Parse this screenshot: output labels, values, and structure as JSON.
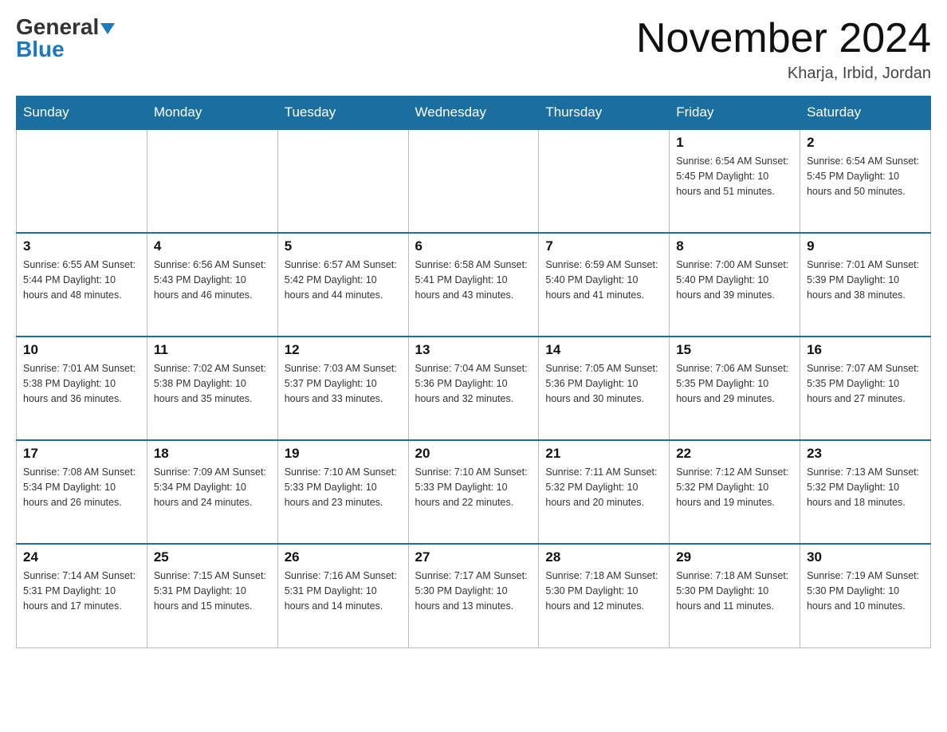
{
  "header": {
    "title": "November 2024",
    "location": "Kharja, Irbid, Jordan",
    "logo_general": "General",
    "logo_blue": "Blue"
  },
  "days_of_week": [
    "Sunday",
    "Monday",
    "Tuesday",
    "Wednesday",
    "Thursday",
    "Friday",
    "Saturday"
  ],
  "weeks": [
    [
      {
        "day": "",
        "info": ""
      },
      {
        "day": "",
        "info": ""
      },
      {
        "day": "",
        "info": ""
      },
      {
        "day": "",
        "info": ""
      },
      {
        "day": "",
        "info": ""
      },
      {
        "day": "1",
        "info": "Sunrise: 6:54 AM\nSunset: 5:45 PM\nDaylight: 10 hours\nand 51 minutes."
      },
      {
        "day": "2",
        "info": "Sunrise: 6:54 AM\nSunset: 5:45 PM\nDaylight: 10 hours\nand 50 minutes."
      }
    ],
    [
      {
        "day": "3",
        "info": "Sunrise: 6:55 AM\nSunset: 5:44 PM\nDaylight: 10 hours\nand 48 minutes."
      },
      {
        "day": "4",
        "info": "Sunrise: 6:56 AM\nSunset: 5:43 PM\nDaylight: 10 hours\nand 46 minutes."
      },
      {
        "day": "5",
        "info": "Sunrise: 6:57 AM\nSunset: 5:42 PM\nDaylight: 10 hours\nand 44 minutes."
      },
      {
        "day": "6",
        "info": "Sunrise: 6:58 AM\nSunset: 5:41 PM\nDaylight: 10 hours\nand 43 minutes."
      },
      {
        "day": "7",
        "info": "Sunrise: 6:59 AM\nSunset: 5:40 PM\nDaylight: 10 hours\nand 41 minutes."
      },
      {
        "day": "8",
        "info": "Sunrise: 7:00 AM\nSunset: 5:40 PM\nDaylight: 10 hours\nand 39 minutes."
      },
      {
        "day": "9",
        "info": "Sunrise: 7:01 AM\nSunset: 5:39 PM\nDaylight: 10 hours\nand 38 minutes."
      }
    ],
    [
      {
        "day": "10",
        "info": "Sunrise: 7:01 AM\nSunset: 5:38 PM\nDaylight: 10 hours\nand 36 minutes."
      },
      {
        "day": "11",
        "info": "Sunrise: 7:02 AM\nSunset: 5:38 PM\nDaylight: 10 hours\nand 35 minutes."
      },
      {
        "day": "12",
        "info": "Sunrise: 7:03 AM\nSunset: 5:37 PM\nDaylight: 10 hours\nand 33 minutes."
      },
      {
        "day": "13",
        "info": "Sunrise: 7:04 AM\nSunset: 5:36 PM\nDaylight: 10 hours\nand 32 minutes."
      },
      {
        "day": "14",
        "info": "Sunrise: 7:05 AM\nSunset: 5:36 PM\nDaylight: 10 hours\nand 30 minutes."
      },
      {
        "day": "15",
        "info": "Sunrise: 7:06 AM\nSunset: 5:35 PM\nDaylight: 10 hours\nand 29 minutes."
      },
      {
        "day": "16",
        "info": "Sunrise: 7:07 AM\nSunset: 5:35 PM\nDaylight: 10 hours\nand 27 minutes."
      }
    ],
    [
      {
        "day": "17",
        "info": "Sunrise: 7:08 AM\nSunset: 5:34 PM\nDaylight: 10 hours\nand 26 minutes."
      },
      {
        "day": "18",
        "info": "Sunrise: 7:09 AM\nSunset: 5:34 PM\nDaylight: 10 hours\nand 24 minutes."
      },
      {
        "day": "19",
        "info": "Sunrise: 7:10 AM\nSunset: 5:33 PM\nDaylight: 10 hours\nand 23 minutes."
      },
      {
        "day": "20",
        "info": "Sunrise: 7:10 AM\nSunset: 5:33 PM\nDaylight: 10 hours\nand 22 minutes."
      },
      {
        "day": "21",
        "info": "Sunrise: 7:11 AM\nSunset: 5:32 PM\nDaylight: 10 hours\nand 20 minutes."
      },
      {
        "day": "22",
        "info": "Sunrise: 7:12 AM\nSunset: 5:32 PM\nDaylight: 10 hours\nand 19 minutes."
      },
      {
        "day": "23",
        "info": "Sunrise: 7:13 AM\nSunset: 5:32 PM\nDaylight: 10 hours\nand 18 minutes."
      }
    ],
    [
      {
        "day": "24",
        "info": "Sunrise: 7:14 AM\nSunset: 5:31 PM\nDaylight: 10 hours\nand 17 minutes."
      },
      {
        "day": "25",
        "info": "Sunrise: 7:15 AM\nSunset: 5:31 PM\nDaylight: 10 hours\nand 15 minutes."
      },
      {
        "day": "26",
        "info": "Sunrise: 7:16 AM\nSunset: 5:31 PM\nDaylight: 10 hours\nand 14 minutes."
      },
      {
        "day": "27",
        "info": "Sunrise: 7:17 AM\nSunset: 5:30 PM\nDaylight: 10 hours\nand 13 minutes."
      },
      {
        "day": "28",
        "info": "Sunrise: 7:18 AM\nSunset: 5:30 PM\nDaylight: 10 hours\nand 12 minutes."
      },
      {
        "day": "29",
        "info": "Sunrise: 7:18 AM\nSunset: 5:30 PM\nDaylight: 10 hours\nand 11 minutes."
      },
      {
        "day": "30",
        "info": "Sunrise: 7:19 AM\nSunset: 5:30 PM\nDaylight: 10 hours\nand 10 minutes."
      }
    ]
  ]
}
